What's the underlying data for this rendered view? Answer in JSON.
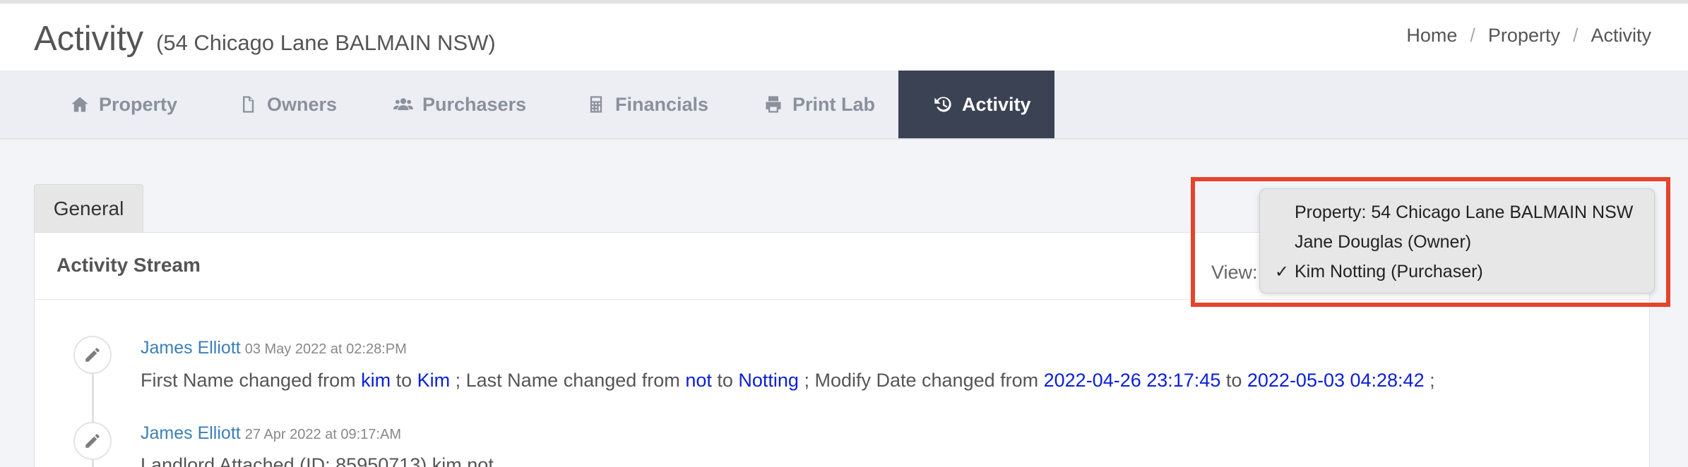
{
  "header": {
    "title": "Activity",
    "subtitle": "(54 Chicago Lane BALMAIN NSW)",
    "breadcrumb": [
      "Home",
      "Property",
      "Activity"
    ],
    "breadcrumb_separator": "/"
  },
  "nav": {
    "tabs": [
      {
        "label": "Property",
        "icon": "home-icon"
      },
      {
        "label": "Owners",
        "icon": "file-icon"
      },
      {
        "label": "Purchasers",
        "icon": "users-icon"
      },
      {
        "label": "Financials",
        "icon": "calculator-icon"
      },
      {
        "label": "Print Lab",
        "icon": "printer-icon"
      },
      {
        "label": "Activity",
        "icon": "history-icon",
        "active": true
      }
    ]
  },
  "section": {
    "tab_label": "General"
  },
  "panel": {
    "title": "Activity Stream",
    "view_label": "View:"
  },
  "dropdown": {
    "options": [
      {
        "label": "Property: 54 Chicago Lane BALMAIN NSW",
        "selected": false
      },
      {
        "label": "Jane Douglas (Owner)",
        "selected": false
      },
      {
        "label": "Kim Notting (Purchaser)",
        "selected": true
      }
    ],
    "check_mark": "✓"
  },
  "timeline": [
    {
      "author": "James Elliott",
      "date": "03 May 2022 at 02:28:PM",
      "parts": {
        "p1": "First Name changed from ",
        "v1": "kim",
        "p2": " to ",
        "v2": "Kim",
        "p3": " ; Last Name changed from ",
        "v3": "not",
        "p4": " to ",
        "v4": "Notting",
        "p5": " ; Modify Date changed from ",
        "v5": "2022-04-26 23:17:45",
        "p6": " to ",
        "v6": "2022-05-03 04:28:42",
        "p7": " ;"
      }
    },
    {
      "author": "James Elliott",
      "date": "27 Apr 2022 at 09:17:AM",
      "text": "Landlord Attached (ID: 85950713) kim not"
    }
  ],
  "colors": {
    "active_tab_bg": "#3b4254",
    "link": "#3c7fb8",
    "changed_value": "#0a1fd8",
    "highlight": "#e5432b"
  }
}
